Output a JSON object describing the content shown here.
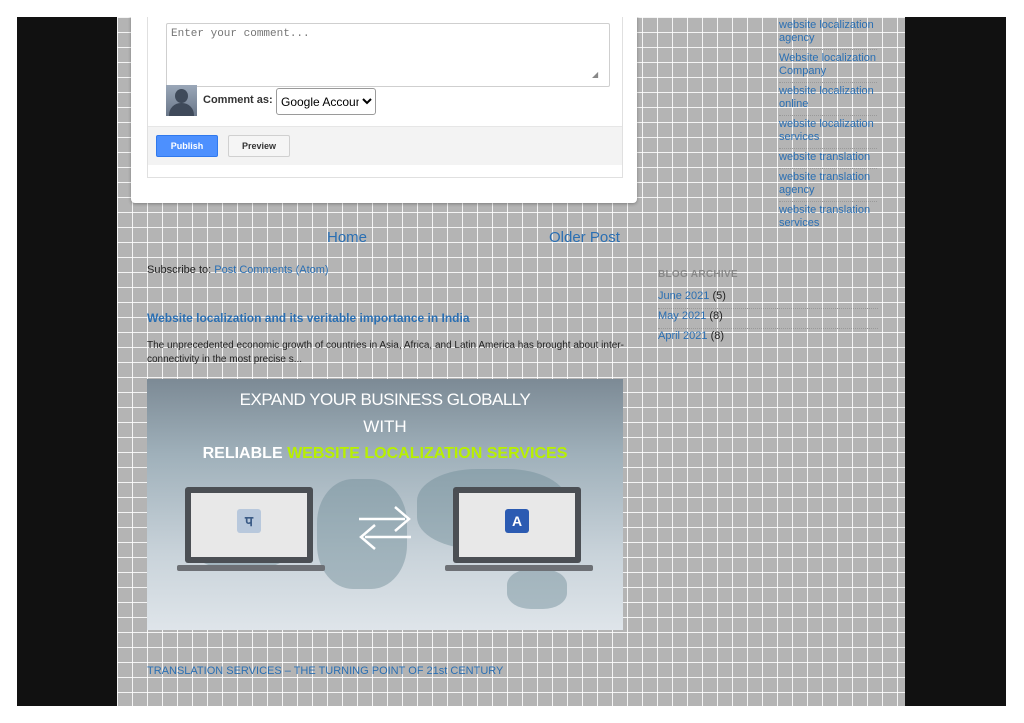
{
  "comment_form": {
    "placeholder": "Enter your comment...",
    "comment_as_label": "Comment as:",
    "account_selected": "Google Accoun",
    "publish_label": "Publish",
    "preview_label": "Preview"
  },
  "pager": {
    "home_label": "Home",
    "older_label": "Older Post"
  },
  "subscribe": {
    "prefix": "Subscribe to: ",
    "link": "Post Comments (Atom)"
  },
  "related_post": {
    "title": "Website localization and its veritable importance in India",
    "snippet": "The unprecedented economic growth of countries in Asia, Africa, and Latin America has brought about inter-connectivity in the most precise s...",
    "image": {
      "line1": "EXPAND YOUR BUSINESS GLOBALLY",
      "line2": "WITH",
      "line3_prefix": "RELIABLE ",
      "line3_highlight": "WEBSITE LOCALIZATION SERVICES",
      "left_tile_glyph": "प",
      "right_tile_glyph": "A"
    }
  },
  "next_post_link": "TRANSLATION SERVICES – THE TURNING POINT OF 21st CENTURY",
  "sidebar": {
    "labels": [
      "website localization agency",
      "Website localization Company",
      "website localization online",
      "website localization services",
      "website translation",
      "website translation agency",
      "website translation services"
    ],
    "archive_title": "BLOG ARCHIVE",
    "archive": [
      {
        "month": "June 2021",
        "count": "(5)"
      },
      {
        "month": "May 2021",
        "count": "(8)"
      },
      {
        "month": "April 2021",
        "count": "(8)"
      }
    ]
  },
  "colors": {
    "link": "#2a6fb3",
    "publish_button": "#4d90fe",
    "page_bg": "#b4b4b4",
    "frame_bg": "#111111"
  }
}
